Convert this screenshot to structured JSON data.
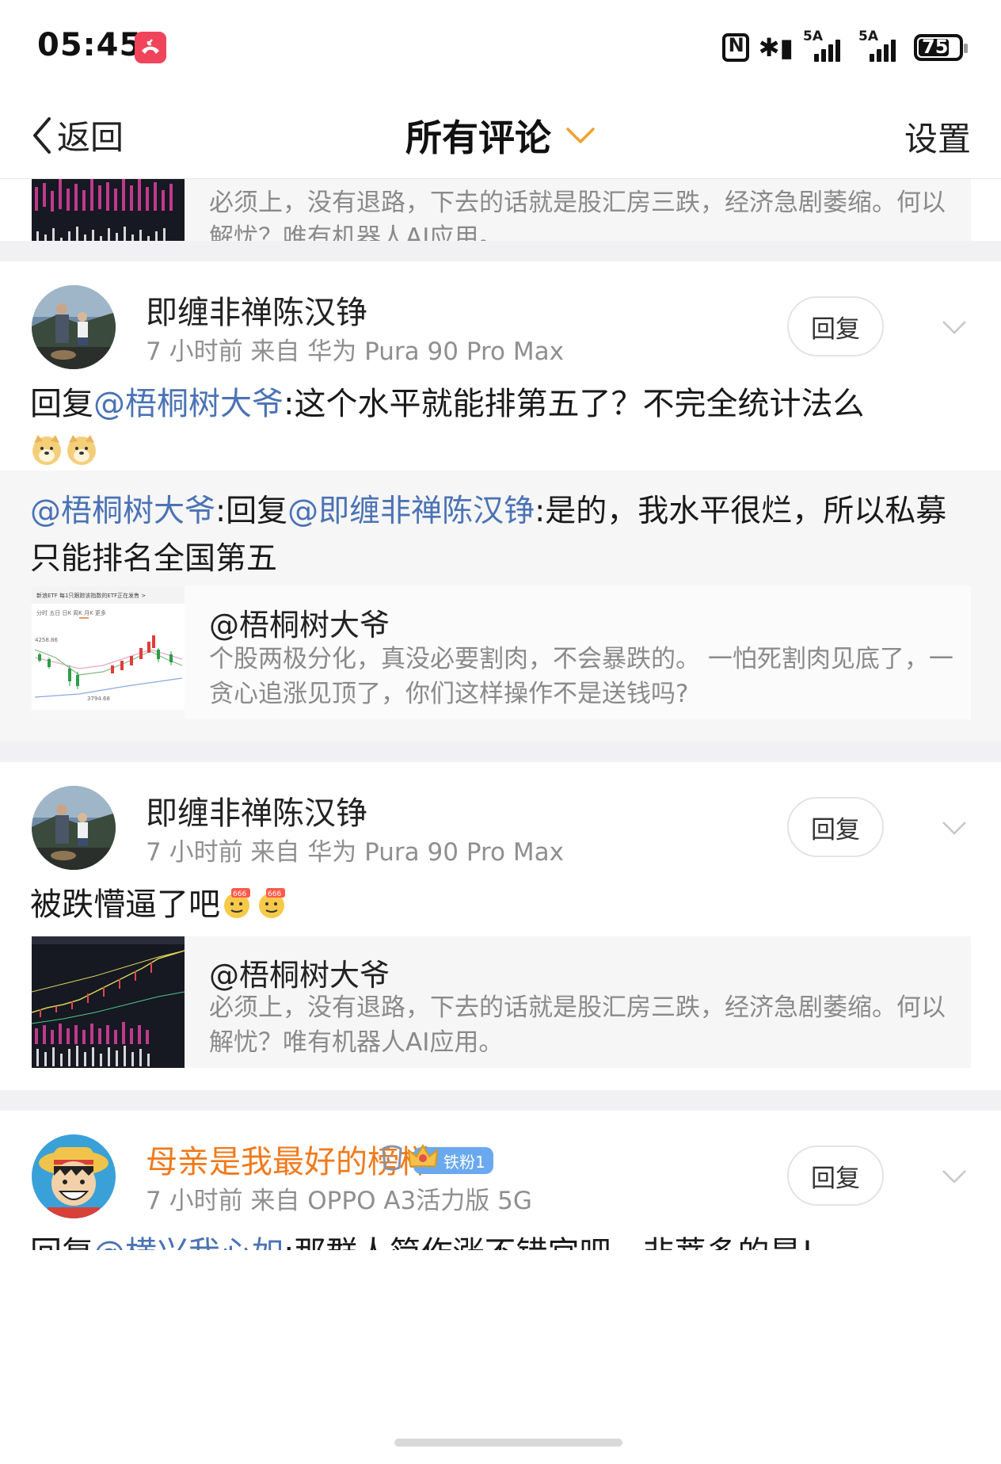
{
  "status_bar": {
    "time": "05:45",
    "signal1_label": "5A",
    "signal2_label": "5A",
    "battery": "75"
  },
  "nav": {
    "back_label": "返回",
    "title": "所有评论",
    "settings_label": "设置"
  },
  "top_quote": {
    "text": "必须上，没有退路，下去的话就是股汇房三跌，经济急剧萎缩。何以解忧？唯有机器人AI应用。"
  },
  "comments": [
    {
      "name": "即缠非禅陈汉铮",
      "meta": "7 小时前  来自 华为 Pura 90 Pro Max",
      "reply_label": "回复",
      "body_prefix": "回复",
      "body_mention": "@梧桐树大爷",
      "body_text": ":这个水平就能排第五了？不完全统计法么"
    },
    {
      "name": "即缠非禅陈汉铮",
      "meta": "7 小时前  来自 华为 Pura 90 Pro Max",
      "reply_label": "回复",
      "body_text": "被跌懵逼了吧"
    },
    {
      "name": "母亲是我最好的榜样",
      "meta": "7 小时前  来自 OPPO A3活力版 5G",
      "reply_label": "回复",
      "fan_badge": "铁粉1",
      "body_prefix": "回复",
      "body_mention": "@横兴我心如",
      "body_text": ":那群人简作涨不错宫吧，非菩多的是!"
    }
  ],
  "subreply": {
    "mention1": "@梧桐树大爷",
    "text1": ":回复",
    "mention2": "@即缠非禅陈汉铮",
    "text2": ":是的，我水平很烂，所以私募只能排名全国第五"
  },
  "quote_card_1": {
    "user": "@梧桐树大爷",
    "text": "个股两极分化，真没必要割肉，不会暴跌的。 一怕死割肉见底了，一贪心追涨见顶了，你们这样操作不是送钱吗?"
  },
  "quote_card_2": {
    "user": "@梧桐树大爷",
    "text": "必须上，没有退路，下去的话就是股汇房三跌，经济急剧萎缩。何以解忧？唯有机器人AI应用。"
  },
  "thumb1_labels": {
    "header": "新浪ETF  每1只跟踪该指数的ETF正在发售 >",
    "tabs": "分时  五日  日K  周K  月K  更多",
    "high": "4258.86",
    "low": "3794.68"
  },
  "colors": {
    "mention": "#4b73b4",
    "vip_name": "#f07a1c",
    "separator": "#f1f1f3",
    "card_bg": "#f6f6f7"
  }
}
